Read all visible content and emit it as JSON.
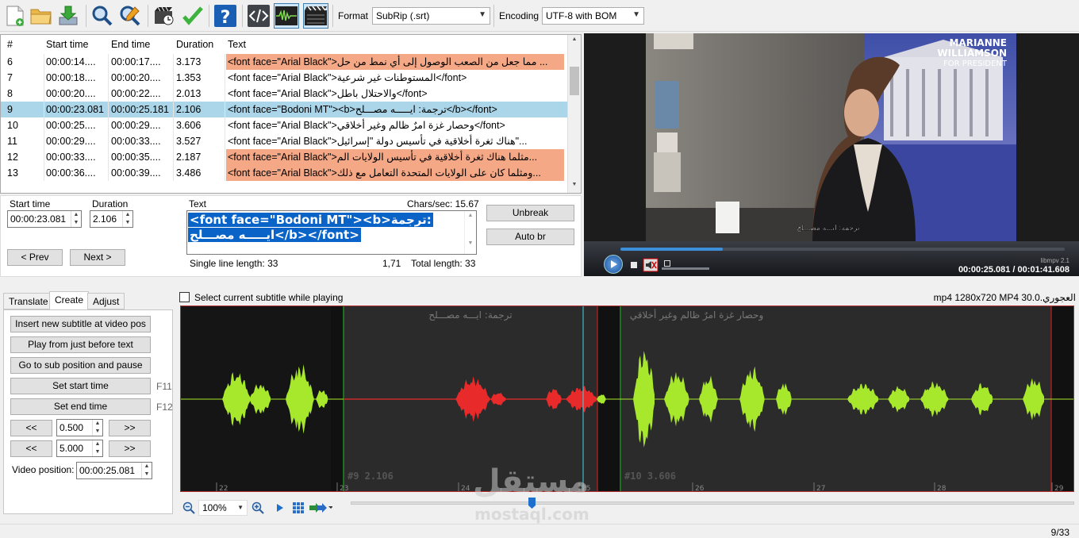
{
  "toolbar": {
    "format_label": "Format",
    "format_value": "SubRip (.srt)",
    "encoding_label": "Encoding",
    "encoding_value": "UTF-8 with BOM",
    "icons": [
      "new-file-icon",
      "open-folder-icon",
      "save-download-icon",
      "find-icon",
      "replace-icon",
      "visual-sync-icon",
      "spell-check-icon",
      "help-icon",
      "source-view-icon",
      "waveform-toggle-icon",
      "video-toggle-icon"
    ]
  },
  "grid": {
    "headers": [
      "#",
      "Start time",
      "End time",
      "Duration",
      "Text"
    ],
    "rows": [
      {
        "num": "6",
        "start": "00:00:14....",
        "end": "00:00:17....",
        "dur": "3.173",
        "text": "<font face=\"Arial Black\">مما جعل من الصعب الوصول إلى أي نمط من حل ...",
        "state": "err"
      },
      {
        "num": "7",
        "start": "00:00:18....",
        "end": "00:00:20....",
        "dur": "1.353",
        "text": "<font face=\"Arial Black\">المستوطنات غير شرعية</font>",
        "state": ""
      },
      {
        "num": "8",
        "start": "00:00:20....",
        "end": "00:00:22....",
        "dur": "2.013",
        "text": "<font face=\"Arial Black\">والاحتلال باطل</font>",
        "state": ""
      },
      {
        "num": "9",
        "start": "00:00:23.081",
        "end": "00:00:25.181",
        "dur": "2.106",
        "text": "<font face=\"Bodoni MT\"><b>ترجمة: ايـــــه مصـــلح</b></font>",
        "state": "sel"
      },
      {
        "num": "10",
        "start": "00:00:25....",
        "end": "00:00:29....",
        "dur": "3.606",
        "text": "<font face=\"Arial Black\">وحصار غزة امرٌ ظالم وغير أخلاقي</font>",
        "state": ""
      },
      {
        "num": "11",
        "start": "00:00:29....",
        "end": "00:00:33....",
        "dur": "3.527",
        "text": "<font face=\"Arial Black\">هناك ثغرة أخلاقية في تأسيس دولة \"إسرائيل\"...",
        "state": ""
      },
      {
        "num": "12",
        "start": "00:00:33....",
        "end": "00:00:35....",
        "dur": "2.187",
        "text": "<font face=\"Arial Black\">مثلما هناك ثغرة أخلاقية في تأسيس الولايات الم...",
        "state": "err"
      },
      {
        "num": "13",
        "start": "00:00:36....",
        "end": "00:00:39....",
        "dur": "3.486",
        "text": "<font face=\"Arial Black\">ومثلما كان على الولايات المتحدة التعامل مع ذلك...",
        "state": "err"
      }
    ]
  },
  "edit": {
    "start_time_label": "Start time",
    "start_time_value": "00:00:23.081",
    "duration_label": "Duration",
    "duration_value": "2.106",
    "text_label": "Text",
    "chars_sec": "Chars/sec: 15.67",
    "text_line1": "<font face=\"Bodoni MT\"><b>ترجمة:",
    "text_line2": "ايـــــه مصـــلح</b></font>",
    "single_line_length": "Single line length: 33",
    "position": "1,71",
    "total_length": "Total length: 33",
    "unbreak": "Unbreak",
    "auto_br": "Auto br",
    "prev": "< Prev",
    "next": "Next >"
  },
  "video": {
    "overlay_line1": "MARIANNE",
    "overlay_line2": "WILLIAMSON",
    "overlay_line3": "FOR PRESIDENT",
    "subtitle": "ترجمة: ايـــه مصـــلح",
    "player_name": "libmpv 2.1",
    "time": "00:00:25.081 / 00:01:41.608"
  },
  "tabs": {
    "translate": "Translate",
    "create": "Create",
    "adjust": "Adjust"
  },
  "create": {
    "insert": "Insert new subtitle at video pos",
    "play_before": "Play from just before text",
    "goto_pause": "Go to sub position and pause",
    "set_start": "Set start time",
    "set_start_key": "F11",
    "set_end": "Set end time",
    "set_end_key": "F12",
    "back": "<<",
    "forward": ">>",
    "step_small": "0.500",
    "step_large": "5.000",
    "video_position_label": "Video position:",
    "video_position_value": "00:00:25.081"
  },
  "wave": {
    "select_current": "Select current subtitle while playing",
    "file_info": "العجوري.mp4 1280x720 MP4 30.0",
    "sub9_text": "ترجمة: ايـــه مصـــلح",
    "sub9_label": "#9  2.106",
    "sub10_text": "وحصار غزة امرٌ ظالم وغير أخلاقي",
    "sub10_label": "#10  3.606",
    "ticks": [
      "22",
      "23",
      "24",
      "25",
      "26",
      "27",
      "28",
      "29"
    ]
  },
  "zoom": {
    "value": "100%"
  },
  "watermark": {
    "arabic": "مستقل",
    "latin": "mostaql.com"
  },
  "status": {
    "count": "9/33"
  }
}
